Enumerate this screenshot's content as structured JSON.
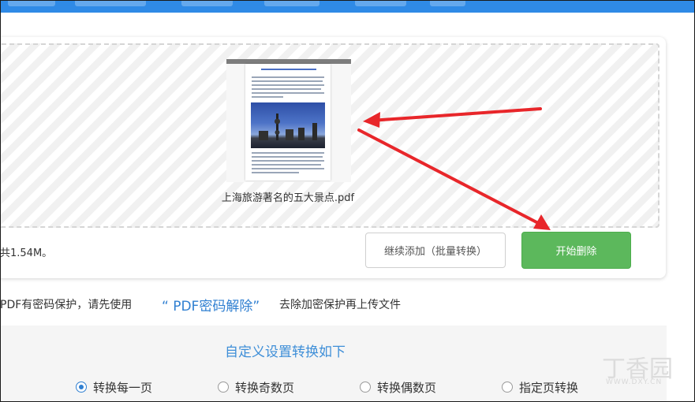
{
  "file": {
    "name": "上海旅游著名的五大景点.pdf",
    "size_info": "共1.54M。"
  },
  "buttons": {
    "continue_label": "继续添加（批量转换）",
    "start_label": "开始删除"
  },
  "notice": {
    "prefix": "PDF有密码保护，请先使用",
    "link": "“ PDF密码解除”",
    "suffix": "去除加密保护再上传文件"
  },
  "settings": {
    "title": "自定义设置转换如下",
    "options": [
      {
        "label": "转换每一页",
        "checked": true
      },
      {
        "label": "转换奇数页",
        "checked": false
      },
      {
        "label": "转换偶数页",
        "checked": false
      },
      {
        "label": "指定页转换",
        "checked": false
      }
    ]
  },
  "watermark": {
    "logo": "丁香园",
    "url": "WWW.DXY.CN"
  },
  "colors": {
    "primary_button": "#5cb85c",
    "link": "#2f7fd1",
    "arrow": "#e8262a"
  }
}
